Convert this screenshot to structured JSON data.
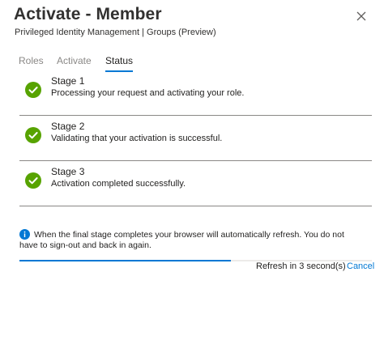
{
  "header": {
    "title": "Activate - Member",
    "subtitle": "Privileged Identity Management | Groups (Preview)",
    "close_icon": "close-icon"
  },
  "tabs": [
    {
      "label": "Roles",
      "active": false
    },
    {
      "label": "Activate",
      "active": false
    },
    {
      "label": "Status",
      "active": true
    }
  ],
  "stages": [
    {
      "title": "Stage 1",
      "description": "Processing your request and activating your role.",
      "icon": "check-circle-icon",
      "status": "complete"
    },
    {
      "title": "Stage 2",
      "description": "Validating that your activation is successful.",
      "icon": "check-circle-icon",
      "status": "complete"
    },
    {
      "title": "Stage 3",
      "description": "Activation completed successfully.",
      "icon": "check-circle-icon",
      "status": "complete"
    }
  ],
  "info": {
    "icon": "info-icon",
    "text": "When the final stage completes your browser will automatically refresh. You do not have to sign-out and back in again."
  },
  "progress": {
    "fraction": 0.6
  },
  "footer": {
    "refresh_text": "Refresh in 3 second(s)",
    "cancel_label": "Cancel"
  },
  "colors": {
    "accent": "#0078d4",
    "success": "#57a300",
    "text": "#323130",
    "muted": "#8a8886"
  }
}
